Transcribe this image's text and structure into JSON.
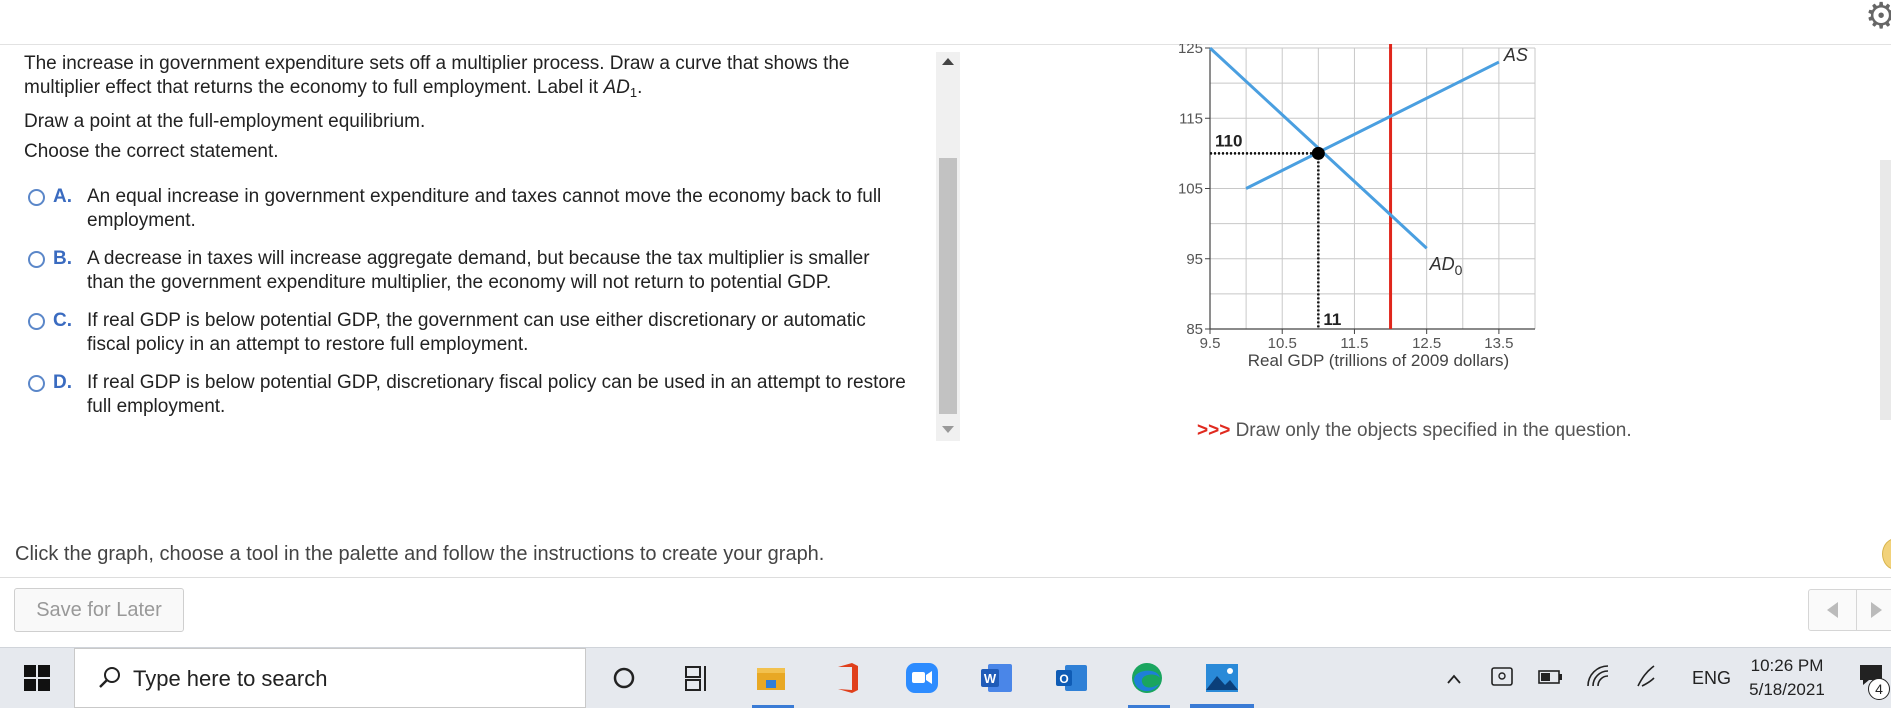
{
  "question": {
    "instruction_line1": "The increase in government expenditure sets off a multiplier process. Draw a curve that shows the",
    "instruction_line2_pre": "multiplier effect that returns the economy to full employment. Label it ",
    "instruction_label": "AD",
    "instruction_label_sub": "1",
    "instruction_line2_post": ".",
    "draw_point": "Draw a point at the full-employment equilibrium.",
    "choose": "Choose the correct statement."
  },
  "options": [
    {
      "letter": "A.",
      "text": "An equal increase in government expenditure and taxes cannot move the economy back to full employment."
    },
    {
      "letter": "B.",
      "text": "A decrease in taxes will increase aggregate demand, but because the tax multiplier is smaller than the government expenditure multiplier, the economy will not return to potential GDP."
    },
    {
      "letter": "C.",
      "text": "If real GDP is below potential GDP, the government can use either discretionary or automatic fiscal policy in an attempt to restore full employment."
    },
    {
      "letter": "D.",
      "text": "If real GDP is below potential GDP, discretionary fiscal policy can be used in an attempt to restore full employment."
    }
  ],
  "chart_data": {
    "type": "line",
    "xlabel": "Real GDP (trillions of 2009 dollars)",
    "ylabel": "",
    "xlim": [
      9.5,
      14
    ],
    "ylim": [
      85,
      125
    ],
    "xticks": [
      "9.5",
      "10.5",
      "11.5",
      "12.5",
      "13.5"
    ],
    "yticks": [
      "85",
      "95",
      "105",
      "115",
      "125"
    ],
    "grid": true,
    "series": [
      {
        "name": "AS",
        "color": "#4a9fe0",
        "points": [
          [
            10,
            105
          ],
          [
            13.5,
            123
          ]
        ]
      },
      {
        "name": "AD",
        "sub": "0",
        "color": "#4a9fe0",
        "points": [
          [
            9.5,
            125
          ],
          [
            12.5,
            96.5
          ]
        ]
      }
    ],
    "vertical_line": {
      "x": 12,
      "color": "#e0261b"
    },
    "equilibrium": {
      "x": 11,
      "y": 110,
      "x_label": "11",
      "y_label": "110"
    }
  },
  "draw_note": {
    "arrows": ">>>",
    "text": " Draw only the objects specified in the question."
  },
  "instruction": "Click the graph, choose a tool in the palette and follow the instructions to create your graph.",
  "save_label": "Save for Later",
  "taskbar": {
    "search_placeholder": "Type here to search",
    "lang": "ENG",
    "time": "10:26 PM",
    "date": "5/18/2021",
    "notification_count": "4"
  }
}
